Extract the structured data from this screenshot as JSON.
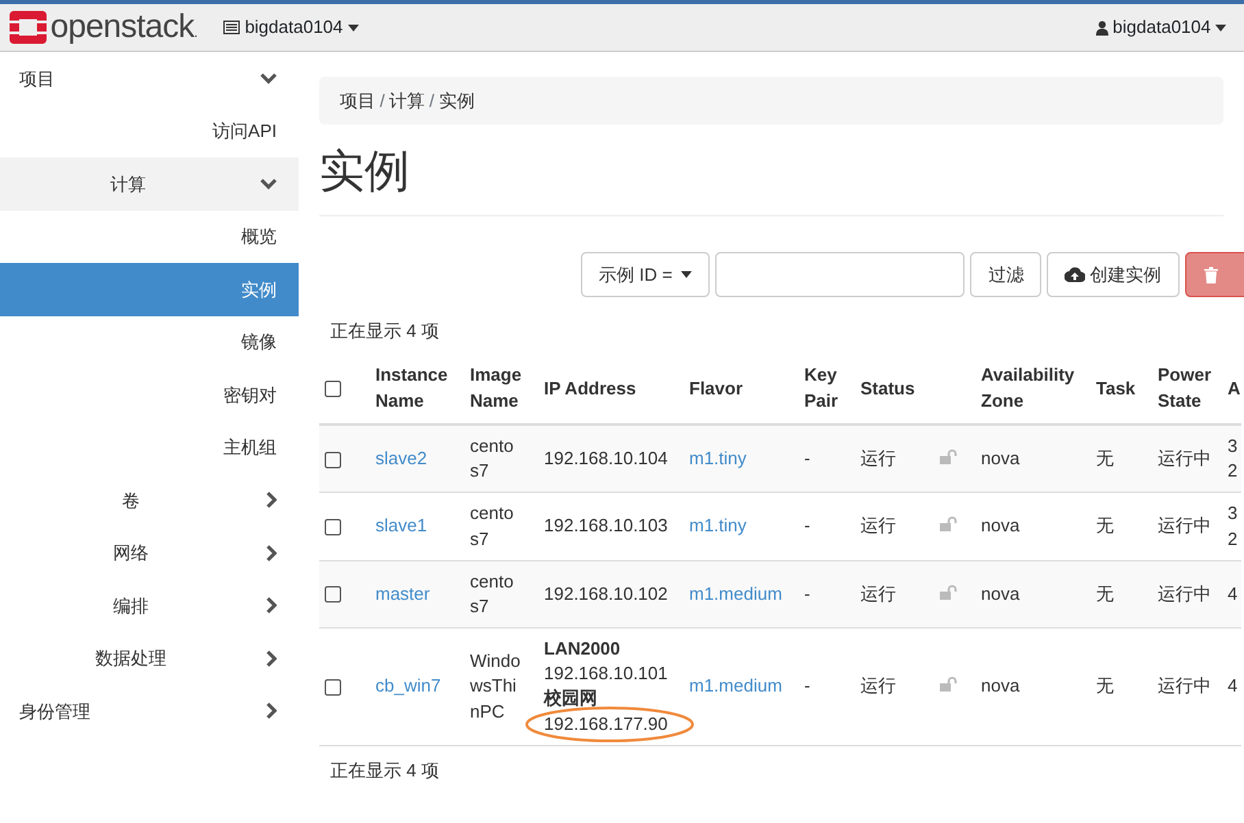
{
  "navbar": {
    "brand": "openstack",
    "brand_mark": ".",
    "project": "bigdata0104",
    "user": "bigdata0104"
  },
  "sidebar": {
    "items": [
      {
        "label": "项目",
        "kind": "group",
        "expanded": true,
        "children": [
          {
            "label": "访问API",
            "kind": "page",
            "selected": false
          },
          {
            "label": "计算",
            "kind": "section",
            "expanded": true,
            "children": [
              {
                "label": "概览",
                "kind": "page",
                "selected": false
              },
              {
                "label": "实例",
                "kind": "page",
                "selected": true
              },
              {
                "label": "镜像",
                "kind": "page",
                "selected": false
              },
              {
                "label": "密钥对",
                "kind": "page",
                "selected": false
              },
              {
                "label": "主机组",
                "kind": "page",
                "selected": false
              }
            ]
          },
          {
            "label": "卷",
            "kind": "section",
            "expanded": false
          },
          {
            "label": "网络",
            "kind": "section",
            "expanded": false
          },
          {
            "label": "编排",
            "kind": "section",
            "expanded": false
          },
          {
            "label": "数据处理",
            "kind": "section",
            "expanded": false
          }
        ]
      },
      {
        "label": "身份管理",
        "kind": "group",
        "expanded": false
      }
    ]
  },
  "breadcrumb": [
    "项目",
    "计算",
    "实例"
  ],
  "breadcrumb_separator": "/",
  "page_title": "实例",
  "toolbar": {
    "filter_select": "示例 ID =",
    "filter_button": "过滤",
    "create_button": "创建实例",
    "delete_disabled": true
  },
  "count_top": "正在显示 4 项",
  "table": {
    "select_all_checked": false,
    "columns": [
      "Instance Name",
      "Image Name",
      "IP Address",
      "Flavor",
      "Key Pair",
      "Status",
      "",
      "Availability Zone",
      "Task",
      "Power State",
      "A"
    ],
    "rows": [
      {
        "selected": false,
        "name": "slave2",
        "image": "centos7",
        "ips": [
          {
            "ip": "192.168.10.104",
            "circled": false
          }
        ],
        "flavor": "m1.tiny",
        "key_pair": "-",
        "status": "运行",
        "locked": false,
        "zone": "nova",
        "task": "无",
        "power": "运行中",
        "column_12": [
          "3",
          "2"
        ]
      },
      {
        "selected": false,
        "name": "slave1",
        "image": "centos7",
        "ips": [
          {
            "ip": "192.168.10.103",
            "circled": false
          }
        ],
        "flavor": "m1.tiny",
        "key_pair": "-",
        "status": "运行",
        "locked": false,
        "zone": "nova",
        "task": "无",
        "power": "运行中",
        "column_12": [
          "3",
          "2"
        ]
      },
      {
        "selected": false,
        "name": "master",
        "image": "centos7",
        "ips": [
          {
            "ip": "192.168.10.102",
            "circled": false
          }
        ],
        "flavor": "m1.medium",
        "key_pair": "-",
        "status": "运行",
        "locked": false,
        "zone": "nova",
        "task": "无",
        "power": "运行中",
        "column_12": [
          "4"
        ]
      },
      {
        "selected": false,
        "name": "cb_win7",
        "image": "WindowsThinPC",
        "ips": [
          {
            "network": "LAN2000",
            "ip": "192.168.10.101",
            "circled": false
          },
          {
            "network": "校园网",
            "ip": "192.168.177.90",
            "circled": true
          }
        ],
        "flavor": "m1.medium",
        "key_pair": "-",
        "status": "运行",
        "locked": false,
        "zone": "nova",
        "task": "无",
        "power": "运行中",
        "column_12": [
          "4"
        ]
      }
    ]
  },
  "count_bottom": "正在显示 4 项"
}
